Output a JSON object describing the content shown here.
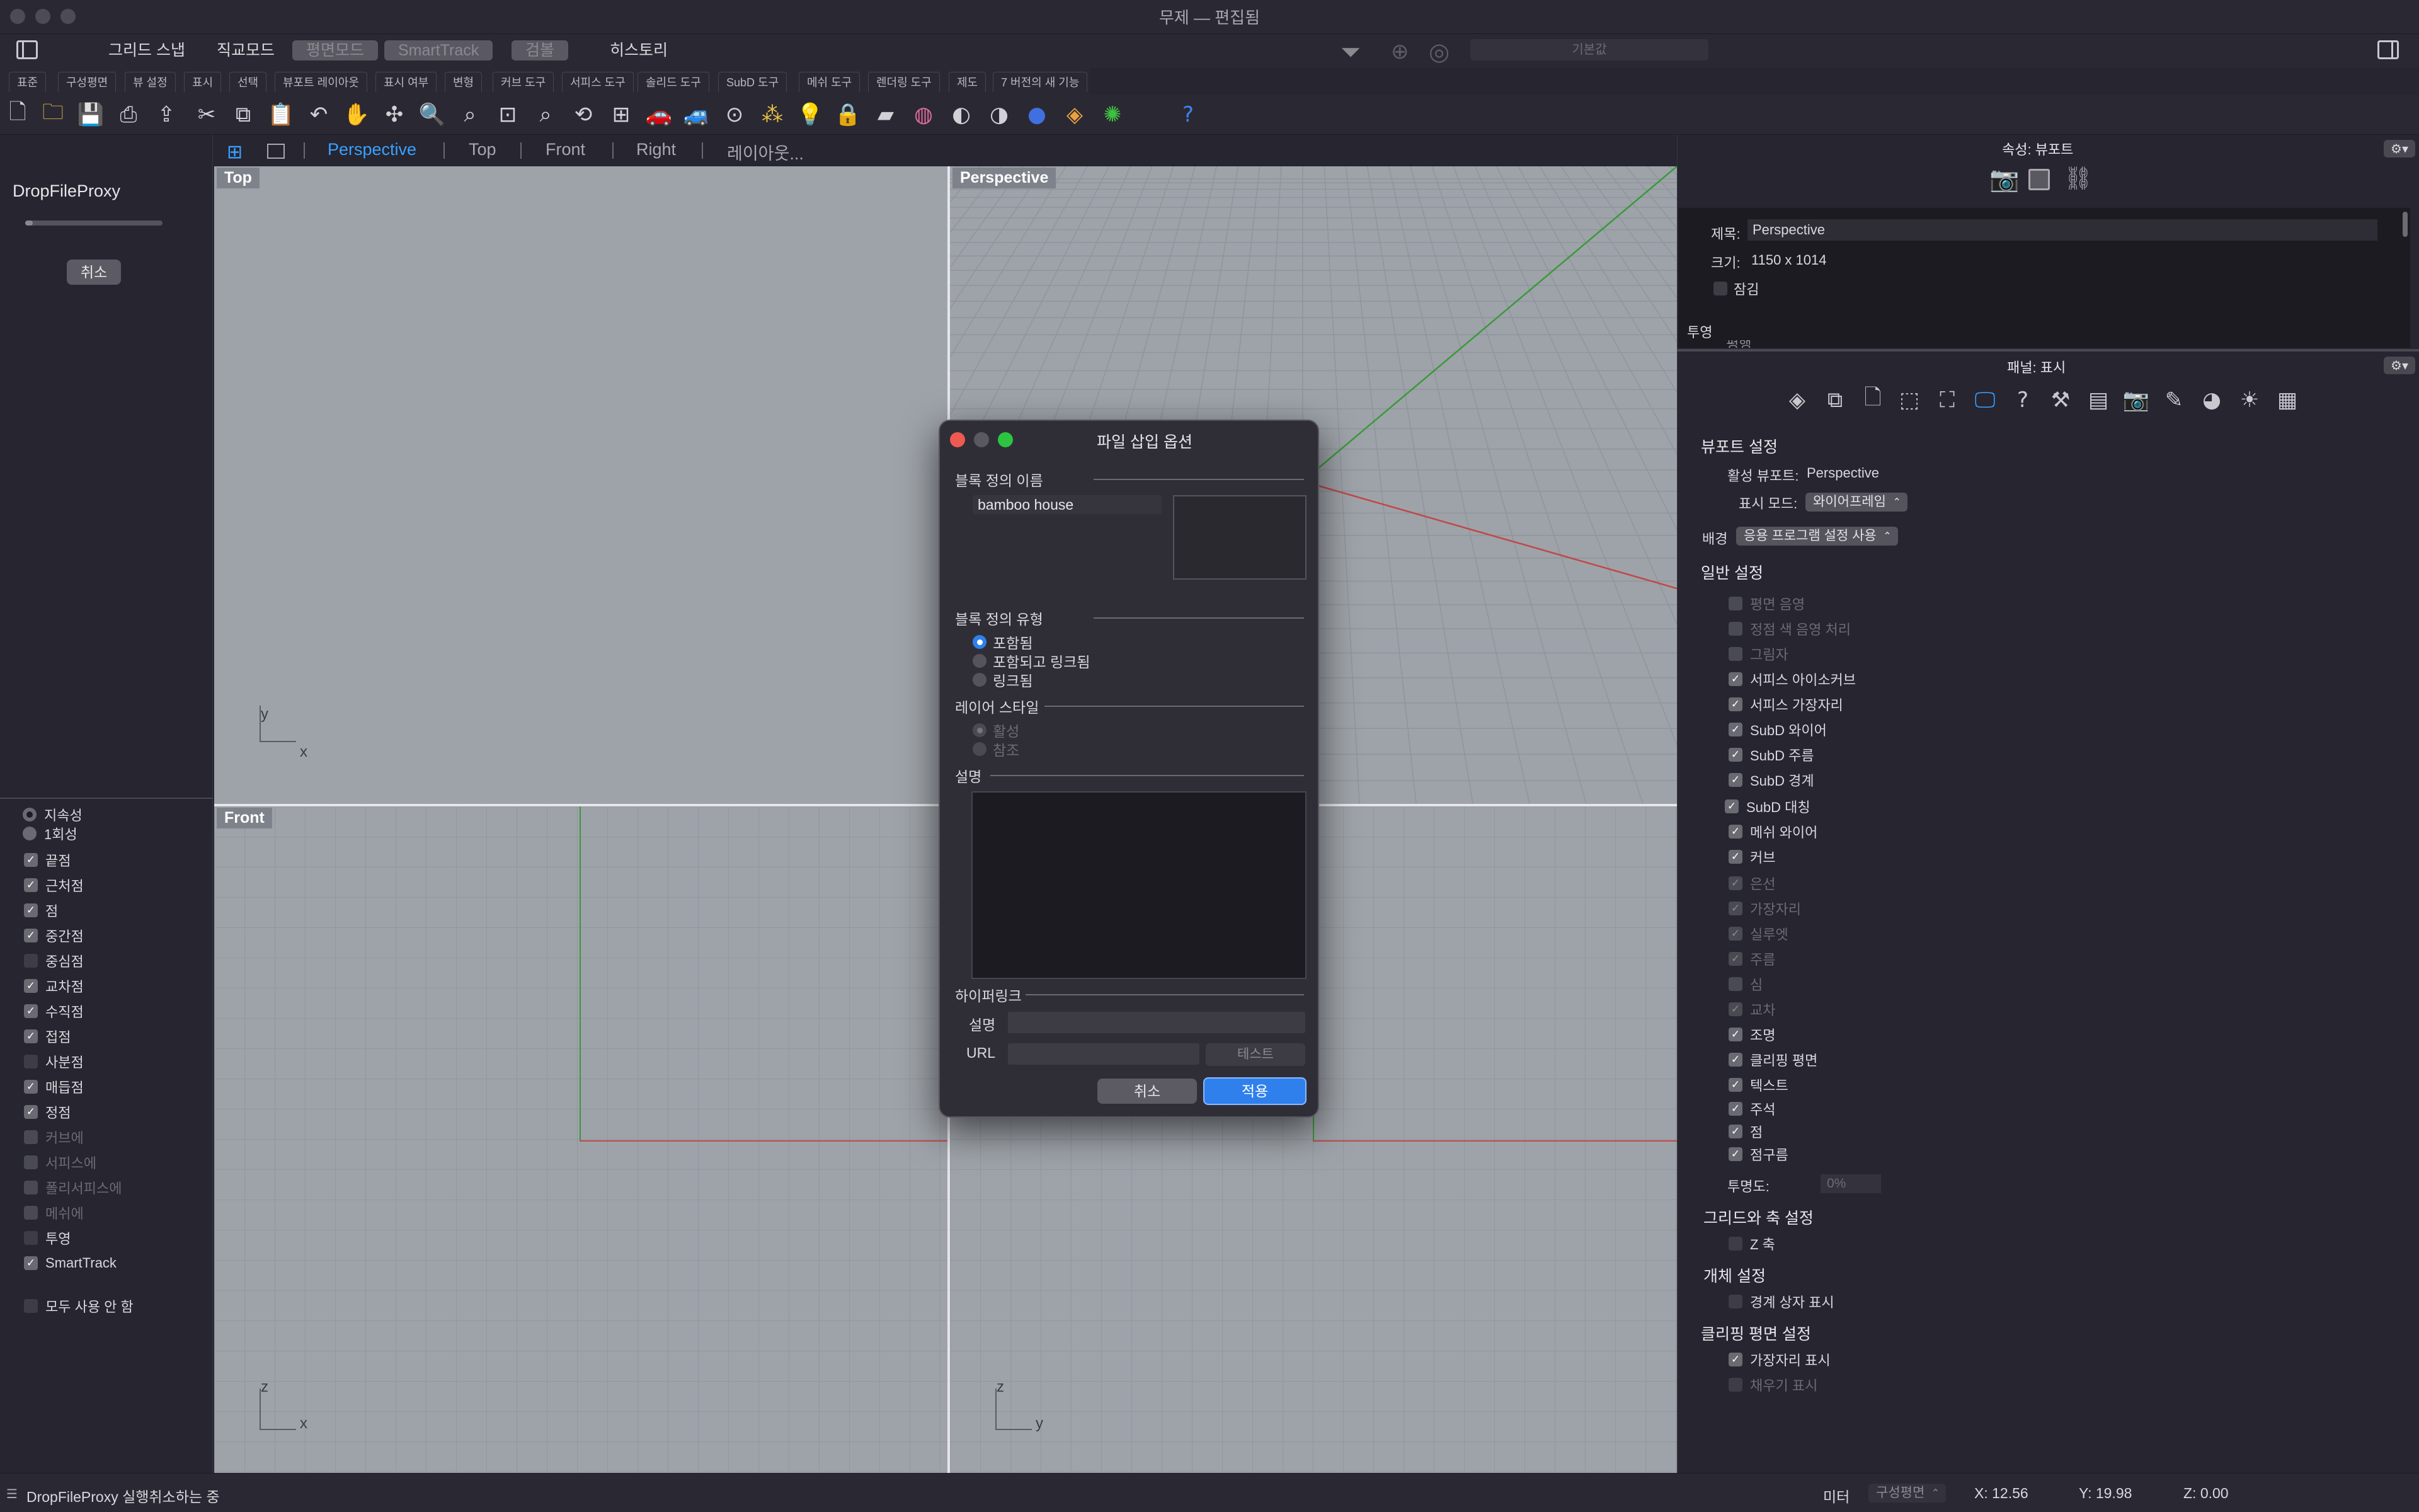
{
  "window": {
    "title": "무제 — 편집됨"
  },
  "modebar": {
    "items": [
      "그리드 스냅",
      "직교모드",
      "평면모드",
      "SmartTrack",
      "검볼",
      "히스토리"
    ],
    "search_placeholder": "기본값"
  },
  "toolbar_tabs": [
    "표준",
    "구성평면",
    "뷰 설정",
    "표시",
    "선택",
    "뷰포트 레이아웃",
    "표시 여부",
    "변형",
    "커브 도구",
    "서피스 도구",
    "솔리드 도구",
    "SubD 도구",
    "메쉬 도구",
    "렌더링 도구",
    "제도",
    "7 버전의 새 기능"
  ],
  "viewport_tabs": {
    "items": [
      "Perspective",
      "Top",
      "Front",
      "Right",
      "레이아웃..."
    ],
    "active": "Perspective"
  },
  "left_panel": {
    "command": "DropFileProxy",
    "cancel_label": "취소"
  },
  "snap_panel": {
    "mode_persistent": "지속성",
    "mode_once": "1회성",
    "items": [
      {
        "label": "끝점",
        "checked": true,
        "enabled": true
      },
      {
        "label": "근처점",
        "checked": true,
        "enabled": true
      },
      {
        "label": "점",
        "checked": true,
        "enabled": true
      },
      {
        "label": "중간점",
        "checked": true,
        "enabled": true
      },
      {
        "label": "중심점",
        "checked": false,
        "enabled": true
      },
      {
        "label": "교차점",
        "checked": true,
        "enabled": true
      },
      {
        "label": "수직점",
        "checked": true,
        "enabled": true
      },
      {
        "label": "접점",
        "checked": true,
        "enabled": true
      },
      {
        "label": "사분점",
        "checked": false,
        "enabled": true
      },
      {
        "label": "매듭점",
        "checked": true,
        "enabled": true
      },
      {
        "label": "정점",
        "checked": true,
        "enabled": true
      },
      {
        "label": "커브에",
        "checked": false,
        "enabled": false
      },
      {
        "label": "서피스에",
        "checked": false,
        "enabled": false
      },
      {
        "label": "폴리서피스에",
        "checked": false,
        "enabled": false
      },
      {
        "label": "메쉬에",
        "checked": false,
        "enabled": false
      },
      {
        "label": "투영",
        "checked": false,
        "enabled": true
      },
      {
        "label": "SmartTrack",
        "checked": true,
        "enabled": true
      }
    ],
    "disable_all": "모두 사용 안 함"
  },
  "viewports": {
    "top": "Top",
    "perspective": "Perspective",
    "front": "Front"
  },
  "axis_labels": {
    "x": "x",
    "y": "y",
    "z": "z"
  },
  "properties_panel": {
    "title": "속성: 뷰포트",
    "title_label": "제목:",
    "title_value": "Perspective",
    "size_label": "크기:",
    "size_value": "1150 x 1014",
    "locked_label": "잠김",
    "projection_label": "투영",
    "projection_cut": "평행"
  },
  "display_panel": {
    "title": "패널: 표시",
    "viewport_settings": "뷰포트 설정",
    "active_viewport_label": "활성 뷰포트:",
    "active_viewport_value": "Perspective",
    "display_mode_label": "표시 모드:",
    "display_mode_value": "와이어프레임",
    "background_label": "배경",
    "background_value": "응용 프로그램 설정 사용",
    "general_settings": "일반 설정",
    "items": [
      {
        "label": "평면 음영",
        "checked": false,
        "enabled": false
      },
      {
        "label": "정점 색 음영 처리",
        "checked": false,
        "enabled": false
      },
      {
        "label": "그림자",
        "checked": false,
        "enabled": false
      },
      {
        "label": "서피스 아이소커브",
        "checked": true,
        "enabled": true
      },
      {
        "label": "서피스 가장자리",
        "checked": true,
        "enabled": true
      },
      {
        "label": "SubD 와이어",
        "checked": true,
        "enabled": true
      },
      {
        "label": "SubD 주름",
        "checked": true,
        "enabled": true
      },
      {
        "label": "SubD 경계",
        "checked": true,
        "enabled": true
      },
      {
        "label": "SubD 대칭",
        "checked": true,
        "enabled": true
      },
      {
        "label": "메쉬 와이어",
        "checked": true,
        "enabled": true
      },
      {
        "label": "커브",
        "checked": true,
        "enabled": true
      },
      {
        "label": "은선",
        "checked": true,
        "enabled": false
      },
      {
        "label": "가장자리",
        "checked": true,
        "enabled": false
      },
      {
        "label": "실루엣",
        "checked": true,
        "enabled": false
      },
      {
        "label": "주름",
        "checked": true,
        "enabled": false
      },
      {
        "label": "심",
        "checked": false,
        "enabled": false
      },
      {
        "label": "교차",
        "checked": true,
        "enabled": false
      },
      {
        "label": "조명",
        "checked": true,
        "enabled": true
      },
      {
        "label": "클리핑 평면",
        "checked": true,
        "enabled": true
      },
      {
        "label": "텍스트",
        "checked": true,
        "enabled": true
      },
      {
        "label": "주석",
        "checked": true,
        "enabled": true
      },
      {
        "label": "점",
        "checked": true,
        "enabled": true
      },
      {
        "label": "점구름",
        "checked": true,
        "enabled": true
      }
    ],
    "transparency_label": "투명도:",
    "transparency_value": "0%",
    "grid_axes_settings": "그리드와 축 설정",
    "z_axis": "Z 축",
    "object_settings": "개체 설정",
    "bbox_display": "경계 상자 표시",
    "clipping_settings": "클리핑 평면 설정",
    "edge_display": "가장자리 표시",
    "fill_display": "채우기 표시"
  },
  "dialog": {
    "title": "파일 삽입 옵션",
    "block_name_label": "블록 정의 이름",
    "block_name_value": "bamboo house",
    "block_type_label": "블록 정의 유형",
    "type_embedded": "포함됨",
    "type_embedded_linked": "포함되고 링크됨",
    "type_linked": "링크됨",
    "layer_style_label": "레이어 스타일",
    "layer_active": "활성",
    "layer_reference": "참조",
    "description_label": "설명",
    "hyperlink_label": "하이퍼링크",
    "hl_description_label": "설명",
    "url_label": "URL",
    "test_label": "테스트",
    "cancel_label": "취소",
    "apply_label": "적용"
  },
  "statusbar": {
    "message": "DropFileProxy 실행취소하는 중",
    "units": "미터",
    "cplane": "구성평면",
    "x": "X: 12.56",
    "y": "Y: 19.98",
    "z": "Z: 0.00"
  }
}
